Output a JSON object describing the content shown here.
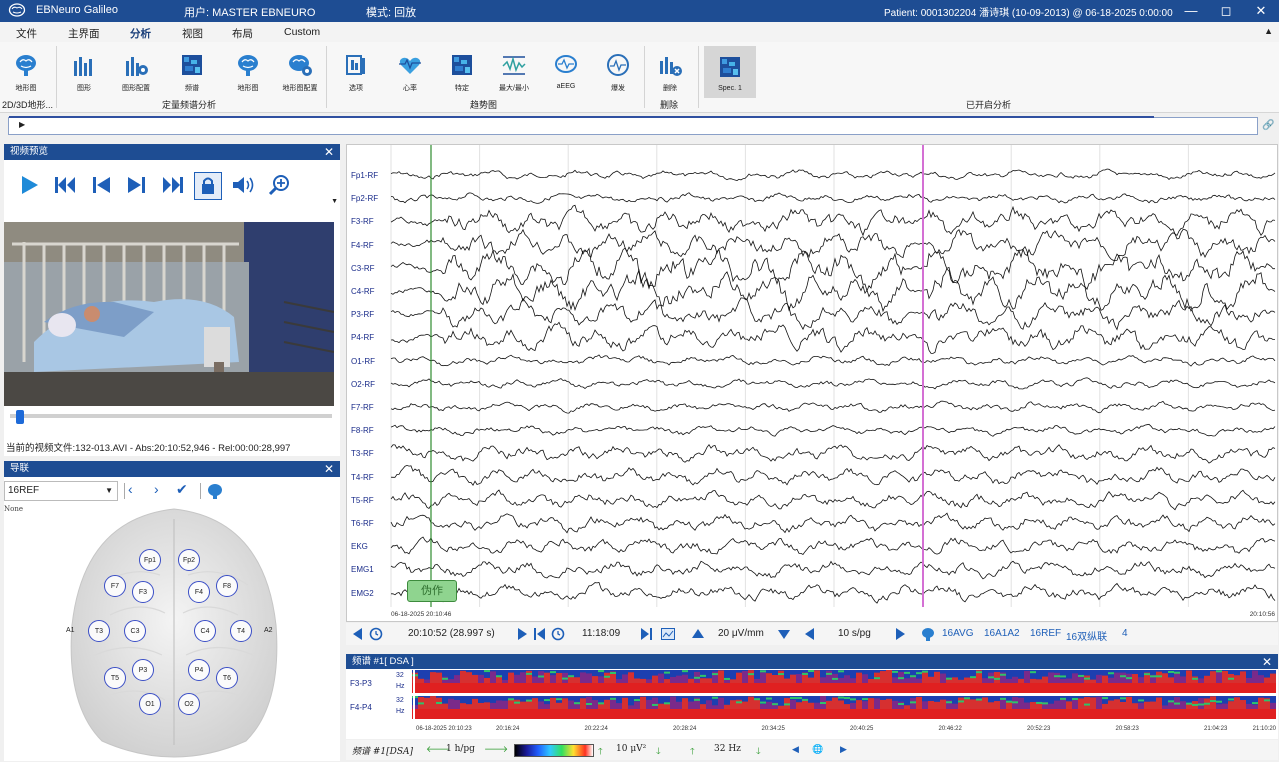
{
  "titlebar": {
    "app": "EBNeuro Galileo",
    "user": "用户: MASTER EBNEURO",
    "mode": "模式: 回放",
    "patient": "Patient: 0001302204  潘诗琪 (10-09-2013) @ 06-18-2025 0:00:00"
  },
  "menu": [
    "文件",
    "主界面",
    "分析",
    "视图",
    "布局",
    "Custom"
  ],
  "ribbon": {
    "buttons": [
      "地形图",
      "图形",
      "图形配置",
      "频谱",
      "地形图",
      "地形图配置",
      "选项",
      "心率",
      "特定",
      "最大/最小",
      "aEEG",
      "爆发",
      "删除",
      "Spec. 1"
    ],
    "groups": [
      "2D/3D地形...",
      "定量频谱分析",
      "趋势图",
      "删除",
      "已开启分析"
    ]
  },
  "video": {
    "title": "视频预览",
    "info": "当前的视频文件:132-013.AVI - Abs:20:10:52,946 - Rel:00:00:28,997",
    "position": 0.02
  },
  "montage": {
    "title": "导联",
    "selected": "16REF",
    "none_label": "None",
    "electrodes": [
      "Fp1",
      "Fp2",
      "F7",
      "F3",
      "F4",
      "F8",
      "A1",
      "T3",
      "C3",
      "C4",
      "T4",
      "A2",
      "P3",
      "P4",
      "T5",
      "T6",
      "O1",
      "O2"
    ]
  },
  "eeg": {
    "channels": [
      "Fp1-RF",
      "Fp2-RF",
      "F3-RF",
      "F4-RF",
      "C3-RF",
      "C4-RF",
      "P3-RF",
      "P4-RF",
      "O1-RF",
      "O2-RF",
      "F7-RF",
      "F8-RF",
      "T3-RF",
      "T4-RF",
      "T5-RF",
      "T6-RF",
      "EKG",
      "EMG1",
      "EMG2"
    ],
    "start_time": "06-18-2025 20:10:46",
    "end_time": "20:10:56",
    "annotation": "伪作",
    "toolbar": {
      "cursor_time": "20:10:52 (28.997 s)",
      "clock": "11:18:09",
      "sensitivity": "20 μV/mm",
      "speed": "10 s/pg",
      "montages": [
        "16AVG",
        "16A1A2",
        "16REF",
        "16双纵联"
      ],
      "count": "4"
    }
  },
  "spectrum": {
    "title": "频谱 #1[ DSA ]",
    "channels": [
      "F3-P3",
      "F4-P4"
    ],
    "hz": "32",
    "hz_unit": "Hz",
    "times": [
      "06-18-2025 20:10:23",
      "20:16:24",
      "20:22:24",
      "20:28:24",
      "20:34:25",
      "20:40:25",
      "20:46:22",
      "20:52:23",
      "20:58:23",
      "21:04:23",
      "21:10:20"
    ],
    "toolbar": {
      "label": "频谱 #1[DSA]",
      "page": "1 h/pg",
      "scale": "10 μV²",
      "freq": "32 Hz"
    }
  },
  "colors": {
    "titlebar": "#1e4d93",
    "cursor_green": "#2e8b2e",
    "cursor_magenta": "#d470d4",
    "channel_label": "#1a2c8a",
    "annotation_fill": "#8fd48f"
  }
}
